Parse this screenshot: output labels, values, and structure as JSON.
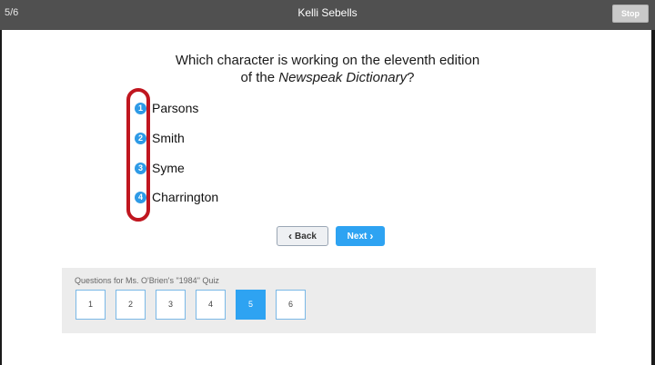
{
  "header": {
    "progress": "5/6",
    "title": "Kelli Sebells",
    "stop_label": "Stop"
  },
  "question": {
    "line1": "Which character is working on the eleventh edition",
    "line2_prefix": "of the ",
    "line2_italic": "Newspeak Dictionary",
    "line2_suffix": "?"
  },
  "answers": [
    {
      "number": "1",
      "label": "Parsons"
    },
    {
      "number": "2",
      "label": "Smith"
    },
    {
      "number": "3",
      "label": "Syme"
    },
    {
      "number": "4",
      "label": "Charrington"
    }
  ],
  "nav": {
    "back_label": "Back",
    "next_label": "Next"
  },
  "quiz": {
    "title": "Questions for Ms. O'Brien's \"1984\" Quiz",
    "questions": [
      "1",
      "2",
      "3",
      "4",
      "5",
      "6"
    ],
    "current": "5"
  },
  "colors": {
    "accent": "#2ea3f2",
    "marker": "#c0161f",
    "titlebar": "#505050"
  }
}
